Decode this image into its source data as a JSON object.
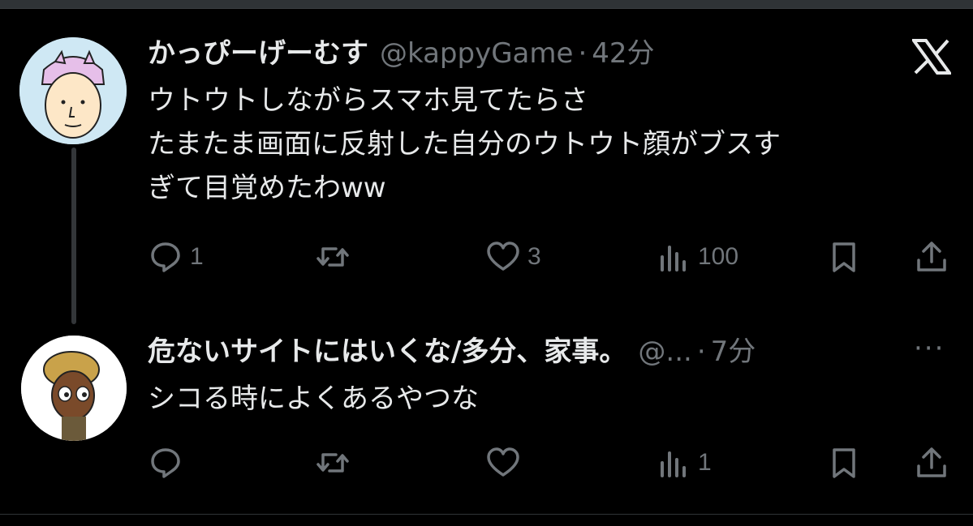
{
  "tweets": [
    {
      "display_name": "かっぴーげーむす",
      "handle": "@kappyGame",
      "separator": "·",
      "time": "42分",
      "text": "ウトウトしながらスマホ見てたらさ\nたまたま画面に反射した自分のウトウト顔がブスす\nぎて目覚めたわww",
      "avatar_icon": "cartoon-man-with-purple-hat-avatar",
      "actions": {
        "reply": "1",
        "retweet": "",
        "like": "3",
        "views": "100"
      }
    },
    {
      "display_name": "危ないサイトにはいくな/多分、家事。",
      "handle": "@...",
      "separator": "·",
      "time": "7分",
      "text": "シコる時によくあるやつな",
      "avatar_icon": "cartoon-man-with-curly-hair-avatar",
      "actions": {
        "reply": "",
        "retweet": "",
        "like": "",
        "views": "1"
      }
    }
  ],
  "more_menu": "···",
  "icons": [
    "x-logo-icon",
    "reply-icon",
    "retweet-icon",
    "like-icon",
    "views-icon",
    "bookmark-icon",
    "share-icon",
    "more-icon"
  ],
  "colors": {
    "background": "#000000",
    "text": "#e7e9ea",
    "secondary": "#71767b",
    "thread_line": "#333639"
  }
}
